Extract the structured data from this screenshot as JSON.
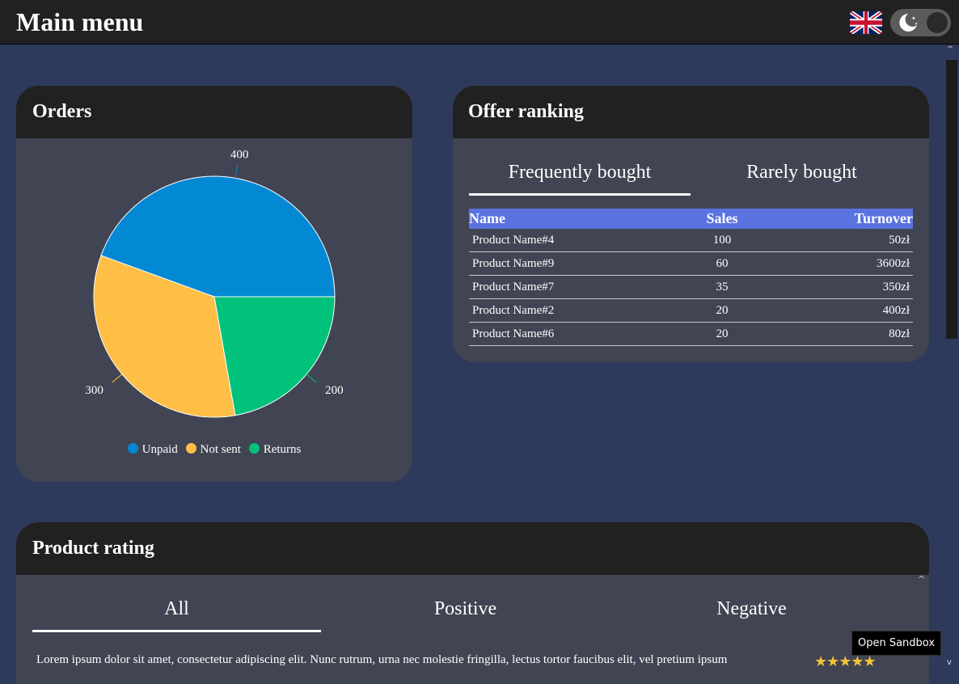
{
  "header": {
    "title": "Main menu",
    "language_flag": "uk-flag-icon",
    "theme_toggle": "moon-icon"
  },
  "orders": {
    "title": "Orders",
    "legend": [
      "Unpaid",
      "Not sent",
      "Returns"
    ]
  },
  "chart_data": {
    "type": "pie",
    "title": "",
    "categories": [
      "Unpaid",
      "Not sent",
      "Returns"
    ],
    "values": [
      400,
      300,
      200
    ],
    "colors": [
      "#0388d4",
      "#ffbe46",
      "#00c27b"
    ],
    "data_labels": [
      "400",
      "300",
      "200"
    ],
    "legend_position": "bottom"
  },
  "offer": {
    "title": "Offer ranking",
    "tabs": [
      "Frequently bought",
      "Rarely bought"
    ],
    "active_tab": 0,
    "columns": [
      "Name",
      "Sales",
      "Turnover"
    ],
    "rows": [
      [
        "Product Name#4",
        "100",
        "50zł"
      ],
      [
        "Product Name#9",
        "60",
        "3600zł"
      ],
      [
        "Product Name#7",
        "35",
        "350zł"
      ],
      [
        "Product Name#2",
        "20",
        "400zł"
      ],
      [
        "Product Name#6",
        "20",
        "80zł"
      ]
    ]
  },
  "rating": {
    "title": "Product rating",
    "tabs": [
      "All",
      "Positive",
      "Negative"
    ],
    "active_tab": 0,
    "review_text": "Lorem ipsum dolor sit amet, consectetur adipiscing elit. Nunc rutrum, urna nec molestie fringilla, lectus tortor faucibus elit, vel pretium ipsum",
    "stars": "★★★★★",
    "star_rating": 5
  },
  "sandbox_button": "Open Sandbox",
  "colors": {
    "background": "#2e3a5b",
    "card": "#414452",
    "header": "#212121",
    "table_header": "#5a73e0"
  }
}
